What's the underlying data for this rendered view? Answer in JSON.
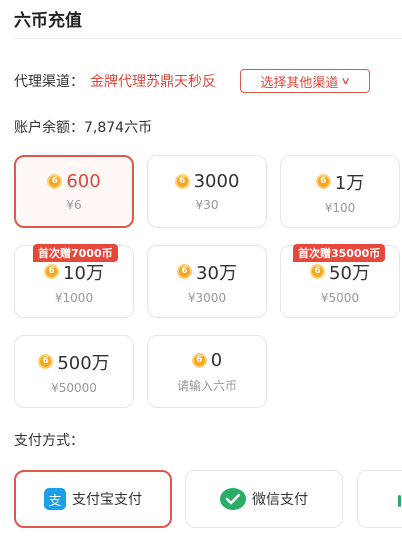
{
  "header": {
    "title": "六币充值"
  },
  "agent": {
    "label": "代理渠道：",
    "name": "金牌代理苏鼎天秒反",
    "switch_label": "选择其他渠道"
  },
  "balance": {
    "text": "账户余额：7,874六币"
  },
  "packages": [
    {
      "amount": "600",
      "price": "¥6",
      "badge": "",
      "selected": true
    },
    {
      "amount": "3000",
      "price": "¥30",
      "badge": ""
    },
    {
      "amount": "1万",
      "price": "¥100",
      "badge": ""
    },
    {
      "amount": "10万",
      "price": "¥1000",
      "badge": "首次赠7000币"
    },
    {
      "amount": "30万",
      "price": "¥3000",
      "badge": ""
    },
    {
      "amount": "50万",
      "price": "¥5000",
      "badge": "首次赠35000币"
    },
    {
      "amount": "500万",
      "price": "¥50000",
      "badge": ""
    },
    {
      "amount": "0",
      "price": "请输入六币",
      "badge": ""
    }
  ],
  "coin_glyph": "6",
  "payment": {
    "label": "支付方式：",
    "methods": [
      {
        "label": "支付宝支付",
        "icon": "alipay-icon",
        "icon_glyph": "支",
        "selected": true
      },
      {
        "label": "微信支付",
        "icon": "wechat-icon",
        "icon_glyph": "●"
      }
    ]
  },
  "colors": {
    "accent": "#e0473b",
    "coin": "#f5a623",
    "alipay": "#1a9fe8",
    "wechat": "#2aae67"
  }
}
